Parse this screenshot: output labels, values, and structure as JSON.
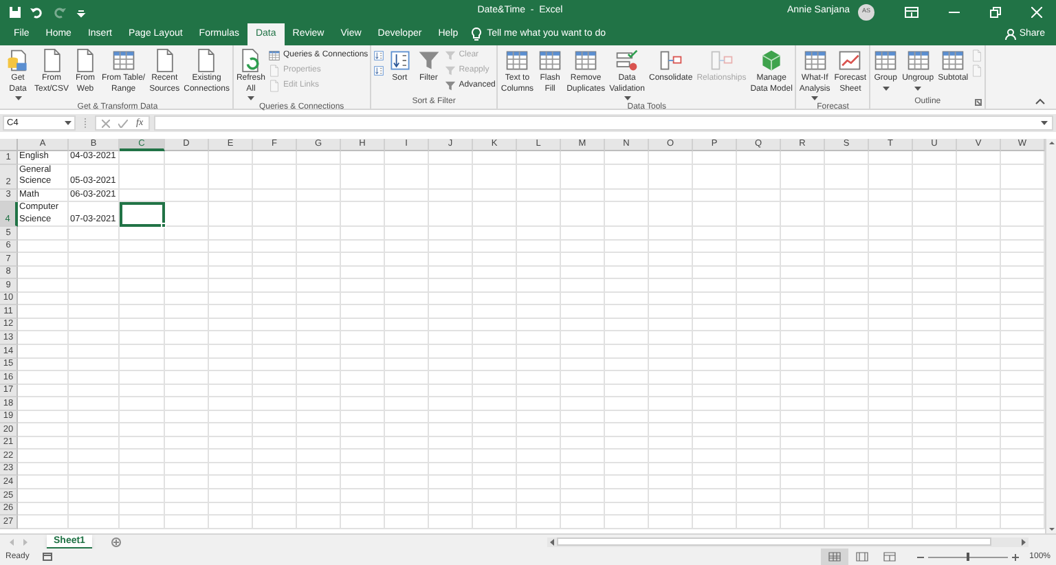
{
  "title_bar": {
    "quick_access": [
      {
        "kind": "save",
        "disabled": false
      },
      {
        "kind": "undo",
        "disabled": false
      },
      {
        "kind": "redo",
        "disabled": true
      },
      {
        "kind": "customize",
        "disabled": false
      }
    ],
    "document_title": "Date&Time  -  Excel",
    "user_name": "Annie Sanjana",
    "user_initials": "AS"
  },
  "tabs": [
    {
      "label": "File",
      "selected": false
    },
    {
      "label": "Home",
      "selected": false
    },
    {
      "label": "Insert",
      "selected": false
    },
    {
      "label": "Page Layout",
      "selected": false
    },
    {
      "label": "Formulas",
      "selected": false
    },
    {
      "label": "Data",
      "selected": true
    },
    {
      "label": "Review",
      "selected": false
    },
    {
      "label": "View",
      "selected": false
    },
    {
      "label": "Developer",
      "selected": false
    },
    {
      "label": "Help",
      "selected": false
    }
  ],
  "tell_me": {
    "placeholder": "Tell me what you want to do"
  },
  "share": "Share",
  "ribbon": {
    "groups": [
      {
        "label": "Get & Transform Data",
        "dialog_launcher": false,
        "controls": [
          {
            "kind": "large",
            "label": "Get\nData",
            "dropdown": true,
            "disabled": false
          },
          {
            "kind": "large",
            "label": "From\nText/CSV",
            "dropdown": false,
            "disabled": false
          },
          {
            "kind": "large",
            "label": "From\nWeb",
            "dropdown": false,
            "disabled": false
          },
          {
            "kind": "large",
            "label": "From Table/\nRange",
            "dropdown": false,
            "disabled": false
          },
          {
            "kind": "large",
            "label": "Recent\nSources",
            "dropdown": false,
            "disabled": false
          },
          {
            "kind": "large",
            "label": "Existing\nConnections",
            "dropdown": false,
            "disabled": false
          }
        ]
      },
      {
        "label": "Queries & Connections",
        "dialog_launcher": false,
        "controls": [
          {
            "kind": "large",
            "label": "Refresh\nAll",
            "dropdown": true,
            "disabled": false
          },
          {
            "kind": "stack",
            "items": [
              {
                "label": "Queries & Connections",
                "disabled": false
              },
              {
                "label": "Properties",
                "disabled": true
              },
              {
                "label": "Edit Links",
                "disabled": true
              }
            ]
          }
        ]
      },
      {
        "label": "Sort & Filter",
        "dialog_launcher": false,
        "controls": [
          {
            "kind": "stack",
            "items": [
              {
                "disabled": false
              },
              {
                "disabled": false
              }
            ]
          },
          {
            "kind": "large",
            "label": "Sort",
            "dropdown": false,
            "disabled": false
          },
          {
            "kind": "large",
            "label": "Filter",
            "dropdown": false,
            "disabled": false
          },
          {
            "kind": "stack",
            "items": [
              {
                "label": "Clear",
                "disabled": true
              },
              {
                "label": "Reapply",
                "disabled": true
              },
              {
                "label": "Advanced",
                "disabled": false
              }
            ]
          }
        ]
      },
      {
        "label": "Data Tools",
        "dialog_launcher": false,
        "controls": [
          {
            "kind": "large",
            "label": "Text to\nColumns",
            "dropdown": false,
            "disabled": false
          },
          {
            "kind": "large",
            "label": "Flash\nFill",
            "dropdown": false,
            "disabled": false
          },
          {
            "kind": "large",
            "label": "Remove\nDuplicates",
            "dropdown": false,
            "disabled": false
          },
          {
            "kind": "large",
            "label": "Data\nValidation",
            "dropdown": true,
            "disabled": false
          },
          {
            "kind": "large",
            "label": "Consolidate",
            "dropdown": false,
            "disabled": false
          },
          {
            "kind": "large",
            "label": "Relationships",
            "dropdown": false,
            "disabled": true
          },
          {
            "kind": "large",
            "label": "Manage\nData Model",
            "dropdown": false,
            "disabled": false
          }
        ]
      },
      {
        "label": "Forecast",
        "dialog_launcher": false,
        "controls": [
          {
            "kind": "large",
            "label": "What-If\nAnalysis",
            "dropdown": true,
            "disabled": false
          },
          {
            "kind": "large",
            "label": "Forecast\nSheet",
            "dropdown": false,
            "disabled": false
          }
        ]
      },
      {
        "label": "Outline",
        "dialog_launcher": true,
        "controls": [
          {
            "kind": "large",
            "label": "Group",
            "dropdown": true,
            "disabled": false
          },
          {
            "kind": "large",
            "label": "Ungroup",
            "dropdown": true,
            "disabled": false
          },
          {
            "kind": "large",
            "label": "Subtotal",
            "dropdown": false,
            "disabled": false
          },
          {
            "kind": "stack",
            "items": [
              {
                "disabled": true
              },
              {
                "disabled": true
              }
            ]
          }
        ]
      }
    ]
  },
  "formula_bar": {
    "name_box": "C4",
    "function_label": "fx"
  },
  "sheet": {
    "columns": [
      {
        "label": "A",
        "selected": false
      },
      {
        "label": "B",
        "selected": false
      },
      {
        "label": "C",
        "selected": true
      },
      {
        "label": "D",
        "selected": false
      },
      {
        "label": "E",
        "selected": false
      },
      {
        "label": "F",
        "selected": false
      },
      {
        "label": "G",
        "selected": false
      },
      {
        "label": "H",
        "selected": false
      },
      {
        "label": "I",
        "selected": false
      },
      {
        "label": "J",
        "selected": false
      },
      {
        "label": "K",
        "selected": false
      },
      {
        "label": "L",
        "selected": false
      },
      {
        "label": "M",
        "selected": false
      },
      {
        "label": "N",
        "selected": false
      },
      {
        "label": "O",
        "selected": false
      },
      {
        "label": "P",
        "selected": false
      },
      {
        "label": "Q",
        "selected": false
      },
      {
        "label": "R",
        "selected": false
      },
      {
        "label": "S",
        "selected": false
      },
      {
        "label": "T",
        "selected": false
      },
      {
        "label": "U",
        "selected": false
      },
      {
        "label": "V",
        "selected": false
      },
      {
        "label": "W",
        "selected": false
      }
    ],
    "rows": [
      {
        "label": "1",
        "selected": false,
        "cells": [
          "English",
          "04-03-2021"
        ]
      },
      {
        "label": "2",
        "selected": false,
        "cells": [
          "General Science",
          "05-03-2021"
        ]
      },
      {
        "label": "3",
        "selected": false,
        "cells": [
          "Math",
          "06-03-2021"
        ]
      },
      {
        "label": "4",
        "selected": true,
        "cells": [
          "Computer Science",
          "07-03-2021"
        ]
      },
      {
        "label": "5",
        "selected": false
      },
      {
        "label": "6",
        "selected": false
      },
      {
        "label": "7",
        "selected": false
      },
      {
        "label": "8",
        "selected": false
      },
      {
        "label": "9",
        "selected": false
      },
      {
        "label": "10",
        "selected": false
      },
      {
        "label": "11",
        "selected": false
      },
      {
        "label": "12",
        "selected": false
      },
      {
        "label": "13",
        "selected": false
      },
      {
        "label": "14",
        "selected": false
      },
      {
        "label": "15",
        "selected": false
      },
      {
        "label": "16",
        "selected": false
      },
      {
        "label": "17",
        "selected": false
      },
      {
        "label": "18",
        "selected": false
      },
      {
        "label": "19",
        "selected": false
      },
      {
        "label": "20",
        "selected": false
      },
      {
        "label": "21",
        "selected": false
      },
      {
        "label": "22",
        "selected": false
      },
      {
        "label": "23",
        "selected": false
      },
      {
        "label": "24",
        "selected": false
      },
      {
        "label": "25",
        "selected": false
      },
      {
        "label": "26",
        "selected": false
      },
      {
        "label": "27",
        "selected": false
      }
    ]
  },
  "sheet_tabs": [
    {
      "label": "Sheet1",
      "selected": true
    }
  ],
  "status_bar": {
    "status": "Ready",
    "views": [
      {
        "kind": "normal",
        "selected": true
      },
      {
        "kind": "page_layout",
        "selected": false
      },
      {
        "kind": "page_break",
        "selected": false
      }
    ],
    "zoom": {
      "level": 0.5,
      "reading": "100%"
    }
  }
}
